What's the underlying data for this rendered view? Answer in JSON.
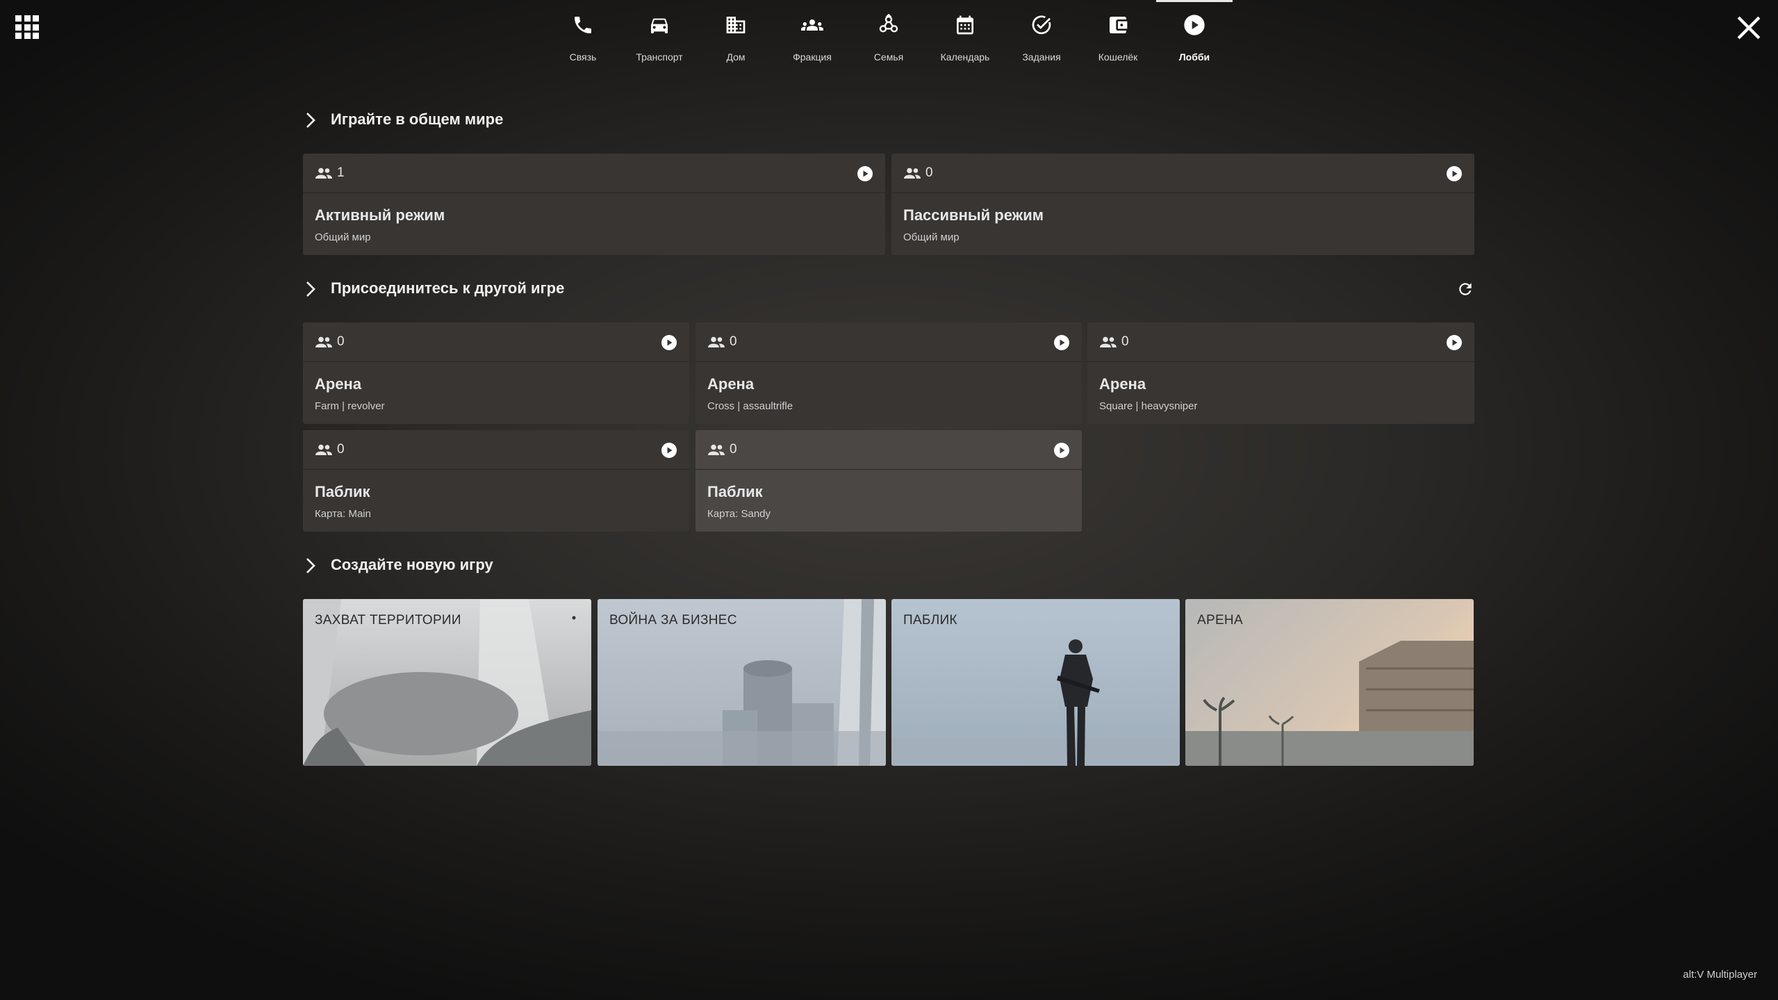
{
  "nav": {
    "items": [
      {
        "label": "Связь",
        "icon": "phone-icon"
      },
      {
        "label": "Транспорт",
        "icon": "car-icon"
      },
      {
        "label": "Дом",
        "icon": "building-icon"
      },
      {
        "label": "Фракция",
        "icon": "group-icon"
      },
      {
        "label": "Семья",
        "icon": "family-icon"
      },
      {
        "label": "Календарь",
        "icon": "calendar-icon"
      },
      {
        "label": "Задания",
        "icon": "check-circle-icon"
      },
      {
        "label": "Кошелёк",
        "icon": "wallet-icon"
      },
      {
        "label": "Лобби",
        "icon": "play-circle-icon"
      }
    ],
    "active": "Лобби"
  },
  "sections": {
    "shared_world": {
      "title": "Играйте в общем мире",
      "cards": [
        {
          "players": "1",
          "title": "Активный режим",
          "subtitle": "Общий мир"
        },
        {
          "players": "0",
          "title": "Пассивный режим",
          "subtitle": "Общий мир"
        }
      ]
    },
    "join_game": {
      "title": "Присоединитесь к другой игре",
      "cards": [
        {
          "players": "0",
          "title": "Арена",
          "subtitle": "Farm | revolver"
        },
        {
          "players": "0",
          "title": "Арена",
          "subtitle": "Cross | assaultrifle"
        },
        {
          "players": "0",
          "title": "Арена",
          "subtitle": "Square | heavysniper"
        },
        {
          "players": "0",
          "title": "Паблик",
          "subtitle": "Карта: Main"
        },
        {
          "players": "0",
          "title": "Паблик",
          "subtitle": "Карта: Sandy"
        }
      ]
    },
    "create_game": {
      "title": "Создайте новую игру",
      "modes": [
        {
          "label": "ЗАХВАТ ТЕРРИТОРИИ"
        },
        {
          "label": "ВОЙНА ЗА БИЗНЕС"
        },
        {
          "label": "ПАБЛИК"
        },
        {
          "label": "АРЕНА"
        }
      ]
    }
  },
  "footer": {
    "brand": "alt:V Multiplayer"
  },
  "colors": {
    "card_bg": "#383533",
    "card_highlight": "#4a4745",
    "text": "#ffffff"
  }
}
